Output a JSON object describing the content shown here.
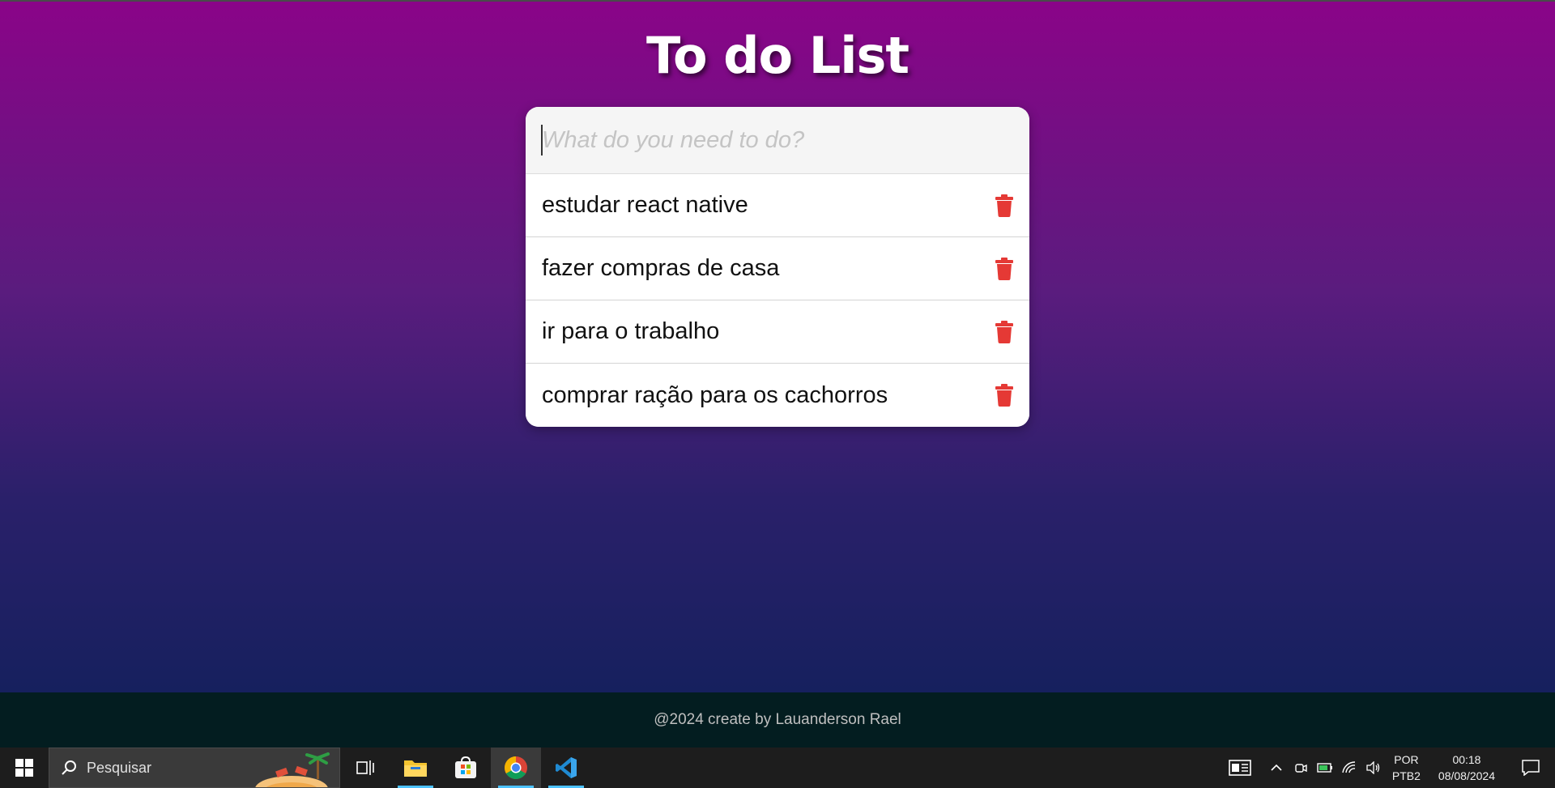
{
  "app": {
    "title": "To do List",
    "input_placeholder": "What do you need to do?",
    "input_value": "",
    "tasks": [
      {
        "text": "estudar react native"
      },
      {
        "text": "fazer compras de casa"
      },
      {
        "text": "ir para o trabalho"
      },
      {
        "text": "comprar ração para os cachorros"
      }
    ],
    "footer": "@2024 create by Lauanderson Rael"
  },
  "colors": {
    "gradient_top": "#8a0488",
    "gradient_bottom": "#16205e",
    "footer_bg": "#031d20",
    "delete_icon": "#e53935"
  },
  "taskbar": {
    "search_placeholder": "Pesquisar",
    "apps": [
      "task-view",
      "file-explorer",
      "microsoft-store",
      "chrome",
      "vscode"
    ],
    "language_line1": "POR",
    "language_line2": "PTB2",
    "time": "00:18",
    "date": "08/08/2024"
  }
}
